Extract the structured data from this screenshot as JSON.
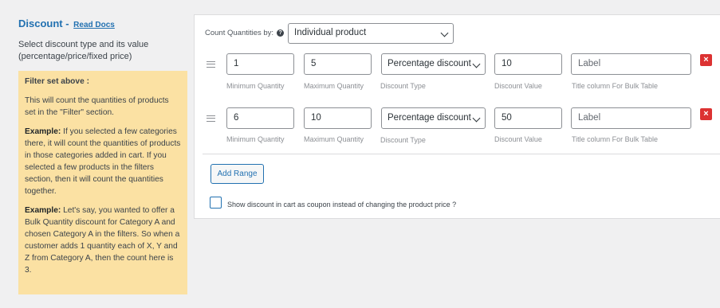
{
  "section": {
    "title": "Discount - ",
    "read_docs": "Read Docs",
    "description": "Select discount type and its value (percentage/price/fixed price)"
  },
  "filter_note": {
    "title": "Filter set above :",
    "p1": "This will count the quantities of products set in the \"Filter\" section.",
    "p2_label": "Example:",
    "p2": " If you selected a few categories there, it will count the quantities of products in those categories added in cart. If you selected a few products in the filters section, then it will count the quantities together.",
    "p3_label": "Example:",
    "p3": " Let's say, you wanted to offer a Bulk Quantity discount for Category A and chosen Category A in the filters. So when a customer adds 1 quantity each of X, Y and Z from Category A, then the count here is 3."
  },
  "count_quantities": {
    "label": "Count Quantities by:",
    "value": "Individual product"
  },
  "captions": {
    "min": "Minimum Quantity",
    "max": "Maximum Quantity",
    "type": "Discount Type",
    "value": "Discount Value",
    "title": "Title column For Bulk Table"
  },
  "ranges": [
    {
      "min": "1",
      "max": "5",
      "type": "Percentage discount",
      "value": "10",
      "label_placeholder": "Label"
    },
    {
      "min": "6",
      "max": "10",
      "type": "Percentage discount",
      "value": "50",
      "label_placeholder": "Label"
    }
  ],
  "add_range_label": "Add Range",
  "coupon_option_label": "Show discount in cart as coupon instead of changing the product price ?",
  "colors": {
    "accent": "#2271b1",
    "note_bg": "#fbe1a3",
    "delete": "#dc3232"
  },
  "icons": {
    "drag": "drag-handle-icon",
    "delete": "close-icon",
    "help": "help-icon",
    "dropdown": "chevron-down-icon"
  }
}
